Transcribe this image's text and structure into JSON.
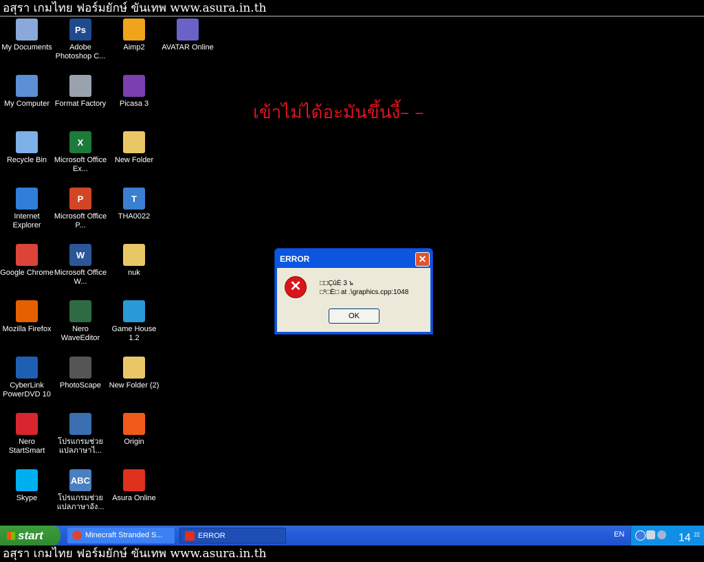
{
  "banner": {
    "text": "อสุรา เกมไทย ฟอร์มยักษ์ ขันเทพ www.asura.in.th"
  },
  "overlay_text": "เข้าไม่ได้อะมันขึ้นงี้– –",
  "desktop_icons": [
    {
      "label": "My Documents",
      "icon": "my-documents-icon",
      "color": "#8aa8d8"
    },
    {
      "label": "My Computer",
      "icon": "my-computer-icon",
      "color": "#5b8fd6"
    },
    {
      "label": "Recycle Bin",
      "icon": "recycle-bin-icon",
      "color": "#7fb0e6"
    },
    {
      "label": "Internet Explorer",
      "icon": "internet-explorer-icon",
      "color": "#2f7fd8"
    },
    {
      "label": "Google Chrome",
      "icon": "chrome-icon",
      "color": "#db4437"
    },
    {
      "label": "Mozilla Firefox",
      "icon": "firefox-icon",
      "color": "#e66000"
    },
    {
      "label": "CyberLink PowerDVD 10",
      "icon": "powerdvd-icon",
      "color": "#1e5fb4"
    },
    {
      "label": "Nero StartSmart",
      "icon": "nero-icon",
      "color": "#d8262e"
    },
    {
      "label": "Skype",
      "icon": "skype-icon",
      "color": "#00aff0"
    },
    {
      "label": "Adobe Photoshop C...",
      "icon": "photoshop-icon",
      "color": "#1f4b8e",
      "glyph": "Ps"
    },
    {
      "label": "Format Factory",
      "icon": "format-factory-icon",
      "color": "#9aa3ad"
    },
    {
      "label": "Microsoft Office Ex...",
      "icon": "excel-icon",
      "color": "#1d7a3a",
      "glyph": "X"
    },
    {
      "label": "Microsoft Office P...",
      "icon": "powerpoint-icon",
      "color": "#d24625",
      "glyph": "P"
    },
    {
      "label": "Microsoft Office W...",
      "icon": "word-icon",
      "color": "#2b5797",
      "glyph": "W"
    },
    {
      "label": "Nero WaveEditor",
      "icon": "wave-editor-icon",
      "color": "#2e6b45"
    },
    {
      "label": "PhotoScape",
      "icon": "photoscape-icon",
      "color": "#555"
    },
    {
      "label": "โปรแกรมช่วยแปลภาษาไ...",
      "icon": "translator-thai-icon",
      "color": "#3a6fb0"
    },
    {
      "label": "โปรแกรมช่วยแปลภาษาอัง...",
      "icon": "translator-eng-icon",
      "color": "#4a7fc0",
      "glyph": "ABC"
    },
    {
      "label": "Aimp2",
      "icon": "aimp-icon",
      "color": "#f0a41c"
    },
    {
      "label": "Picasa 3",
      "icon": "picasa-icon",
      "color": "#7b3fb0"
    },
    {
      "label": "New Folder",
      "icon": "folder-icon",
      "color": "#e9c766"
    },
    {
      "label": "THA0022",
      "icon": "font-file-icon",
      "color": "#3a7fd0",
      "glyph": "T"
    },
    {
      "label": "nuk",
      "icon": "folder-icon",
      "color": "#e9c766"
    },
    {
      "label": "Game House 1.2",
      "icon": "game-house-icon",
      "color": "#2a9ad6"
    },
    {
      "label": "New Folder (2)",
      "icon": "folder-icon",
      "color": "#e9c766"
    },
    {
      "label": "Origin",
      "icon": "origin-icon",
      "color": "#f25a1c"
    },
    {
      "label": "Asura Online",
      "icon": "asura-online-icon",
      "color": "#e0301e"
    },
    {
      "label": "AVATAR Online",
      "icon": "avatar-online-icon",
      "color": "#6a62c8"
    }
  ],
  "dialog": {
    "title": "ERROR",
    "close_glyph": "✕",
    "line1": "□□ÇûÈ 3 ъ",
    "line2": "□¹□È□ at .\\graphics.cpp:1048",
    "ok_label": "OK"
  },
  "taskbar": {
    "start_label": "start",
    "tasks": [
      {
        "label": "Minecraft Stranded S...",
        "icon": "chrome-icon"
      },
      {
        "label": "ERROR",
        "icon": "asura-online-icon"
      }
    ],
    "language": "EN",
    "clock_hour": "14",
    "clock_min": "22"
  }
}
